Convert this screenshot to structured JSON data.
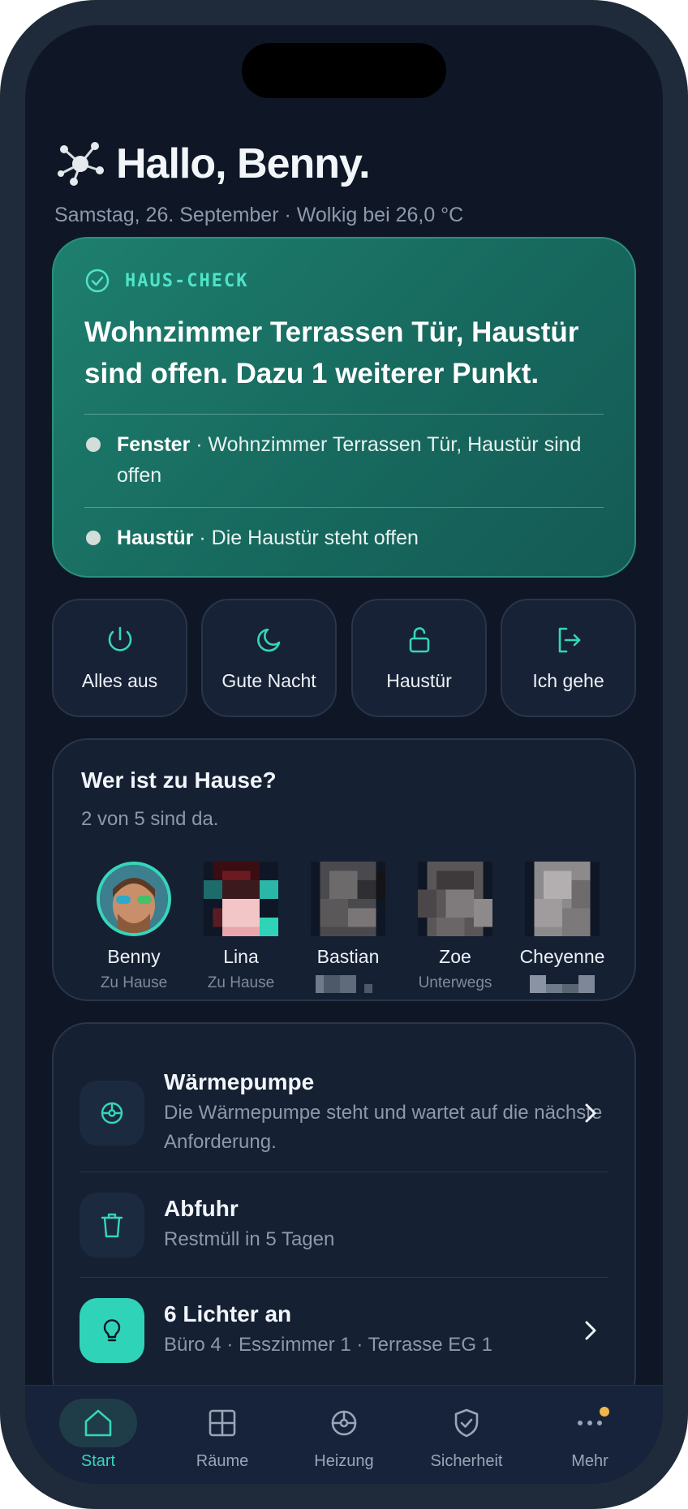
{
  "header": {
    "greeting": "Hallo, Benny.",
    "subtitle": "Samstag, 26. September · Wolkig bei 26,0 °C"
  },
  "haus_check": {
    "tag": "HAUS-CHECK",
    "title": "Wohnzimmer Terrassen Tür, Haustür sind offen. Dazu 1 weiterer Punkt.",
    "items": [
      {
        "label": "Fenster",
        "text": " · Wohnzimmer Terrassen Tür, Haustür sind offen"
      },
      {
        "label": "Haustür",
        "text": " · Die Haustür steht offen"
      }
    ]
  },
  "quick_actions": [
    {
      "label": "Alles aus",
      "icon": "power-icon"
    },
    {
      "label": "Gute Nacht",
      "icon": "moon-icon"
    },
    {
      "label": "Haustür",
      "icon": "unlock-icon"
    },
    {
      "label": "Ich gehe",
      "icon": "exit-icon"
    }
  ],
  "presence": {
    "title": "Wer ist zu Hause?",
    "summary": "2 von 5 sind da.",
    "people": [
      {
        "name": "Benny",
        "status": "Zu Hause"
      },
      {
        "name": "Lina",
        "status": "Zu Hause"
      },
      {
        "name": "Bastian",
        "status": ""
      },
      {
        "name": "Zoe",
        "status": "Unterwegs"
      },
      {
        "name": "Cheyenne",
        "status": ""
      }
    ]
  },
  "status_list": [
    {
      "title": "Wärmepumpe",
      "subtitle": "Die Wärmepumpe steht und wartet auf die nächste Anforderung.",
      "icon": "target-icon"
    },
    {
      "title": "Abfuhr",
      "subtitle": "Restmüll in 5 Tagen",
      "icon": "trash-icon"
    },
    {
      "title": "6 Lichter an",
      "subtitle": "Büro 4 · Esszimmer 1 · Terrasse EG 1",
      "icon": "lightbulb-icon"
    }
  ],
  "nav": {
    "tabs": [
      {
        "label": "Start",
        "icon": "home-icon"
      },
      {
        "label": "Räume",
        "icon": "rooms-icon"
      },
      {
        "label": "Heizung",
        "icon": "heating-icon"
      },
      {
        "label": "Sicherheit",
        "icon": "shield-icon"
      },
      {
        "label": "Mehr",
        "icon": "more-icon"
      }
    ]
  },
  "colors": {
    "accent": "#35d6bb",
    "background": "#0f1726",
    "card": "#152033",
    "check_card": "#1e7f6e",
    "badge": "#f2b84b"
  }
}
